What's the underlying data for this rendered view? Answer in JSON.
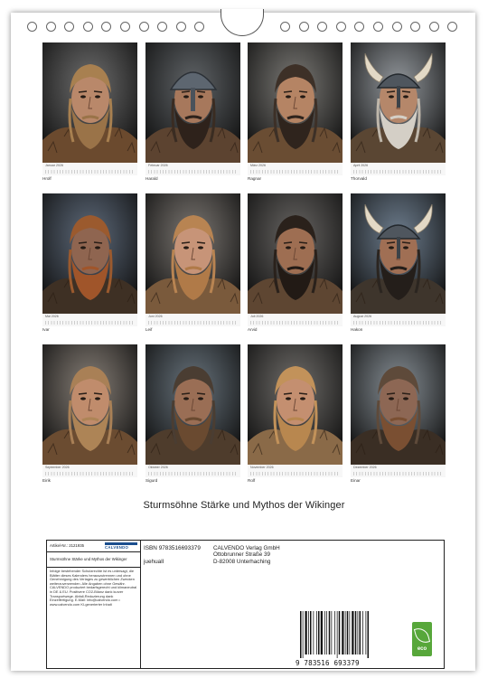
{
  "calendar": {
    "title": "Sturmsöhne Stärke und Mythos der Wikinger",
    "months": [
      {
        "month": "Januar 2026",
        "name": "Hrolf",
        "helmet": "none",
        "hair": "#a88050",
        "beard": "#9a7348",
        "skin": "#b9886a",
        "bg": "#3b3b3b",
        "fur": "#6b4a2e"
      },
      {
        "month": "Februar 2026",
        "name": "Harald",
        "helmet": "steel",
        "hair": "#3a2c22",
        "beard": "#2e221b",
        "skin": "#a7785c",
        "bg": "#2a2f33",
        "fur": "#5c4330"
      },
      {
        "month": "März 2026",
        "name": "Ragnar",
        "helmet": "none",
        "hair": "#3d3027",
        "beard": "#2f241d",
        "skin": "#b58464",
        "bg": "#4c4a45",
        "fur": "#6a4d33"
      },
      {
        "month": "April 2026",
        "name": "Thorvald",
        "helmet": "horned",
        "hair": "#bfb7ab",
        "beard": "#d4cfc6",
        "skin": "#b5876a",
        "bg": "#6a7076",
        "fur": "#5a4633"
      },
      {
        "month": "Mai 2026",
        "name": "Ivar",
        "helmet": "none",
        "hair": "#9b5a2e",
        "beard": "#a0552a",
        "skin": "#8f6550",
        "bg": "#27364a",
        "fur": "#3e3024"
      },
      {
        "month": "Juni 2026",
        "name": "Leif",
        "helmet": "none",
        "hair": "#b88452",
        "beard": "#b07a48",
        "skin": "#c79478",
        "bg": "#4c4640",
        "fur": "#7a5a3c"
      },
      {
        "month": "Juli 2026",
        "name": "Arvid",
        "helmet": "none",
        "hair": "#2a211b",
        "beard": "#221a15",
        "skin": "#9e6e52",
        "bg": "#33302d",
        "fur": "#5e4632"
      },
      {
        "month": "August 2026",
        "name": "Hakon",
        "helmet": "horned",
        "hair": "#2b2520",
        "beard": "#241e1a",
        "skin": "#a06f54",
        "bg": "#3b4f64",
        "fur": "#3e352c"
      },
      {
        "month": "September 2026",
        "name": "Eirik",
        "helmet": "none",
        "hair": "#a98056",
        "beard": "#ad8456",
        "skin": "#c08c6c",
        "bg": "#5a5046",
        "fur": "#6b4c31"
      },
      {
        "month": "Oktober 2026",
        "name": "Sigurd",
        "helmet": "none",
        "hair": "#4a3d32",
        "beard": "#6a4a30",
        "skin": "#9a6e55",
        "bg": "#33414c",
        "fur": "#4e3c2c"
      },
      {
        "month": "November 2026",
        "name": "Rolf",
        "helmet": "none",
        "hair": "#c2925a",
        "beard": "#b8874f",
        "skin": "#c48f70",
        "bg": "#3d3a36",
        "fur": "#8a6a48"
      },
      {
        "month": "Dezember 2026",
        "name": "Einar",
        "helmet": "none",
        "hair": "#5e4a3a",
        "beard": "#7a4f32",
        "skin": "#8d6754",
        "bg": "#5a646c",
        "fur": "#3a2e24"
      }
    ]
  },
  "info": {
    "article_label": "Artikel-Nr.: 2121935",
    "logo": "CALVENDO",
    "product_title": "Sturmsöhne Stärke und Mythos der Wikinger",
    "legal_text": "Infolge bestehender Schutzrechte ist es untersagt, die Blätter dieses Kalenders herauszutrennen und ohne Genehmigung des Verlages zu gewerblichen Zwecken weiterzuverwenden. Alle Angaben ohne Gewähr. CALVENDO produziert bedarfsgerecht und klimaneutral in DE & EU. Positivere CO2-Bilanz dank kurzer Transportwege. Abfall-Reduzierung dank Einzelfertigung. E-Mail: info@calvendo.com • www.calvendo.com KI-generierter Inhalt",
    "isbn": "ISBN 9783516693379",
    "author": "juehuall",
    "publisher_lines": [
      "CALVENDO Verlag GmbH",
      "Ottobrunner Straße 39",
      "D-82008 Unterhaching"
    ],
    "barcode_digits": "9 783516 693379",
    "eco_label": "eco"
  }
}
